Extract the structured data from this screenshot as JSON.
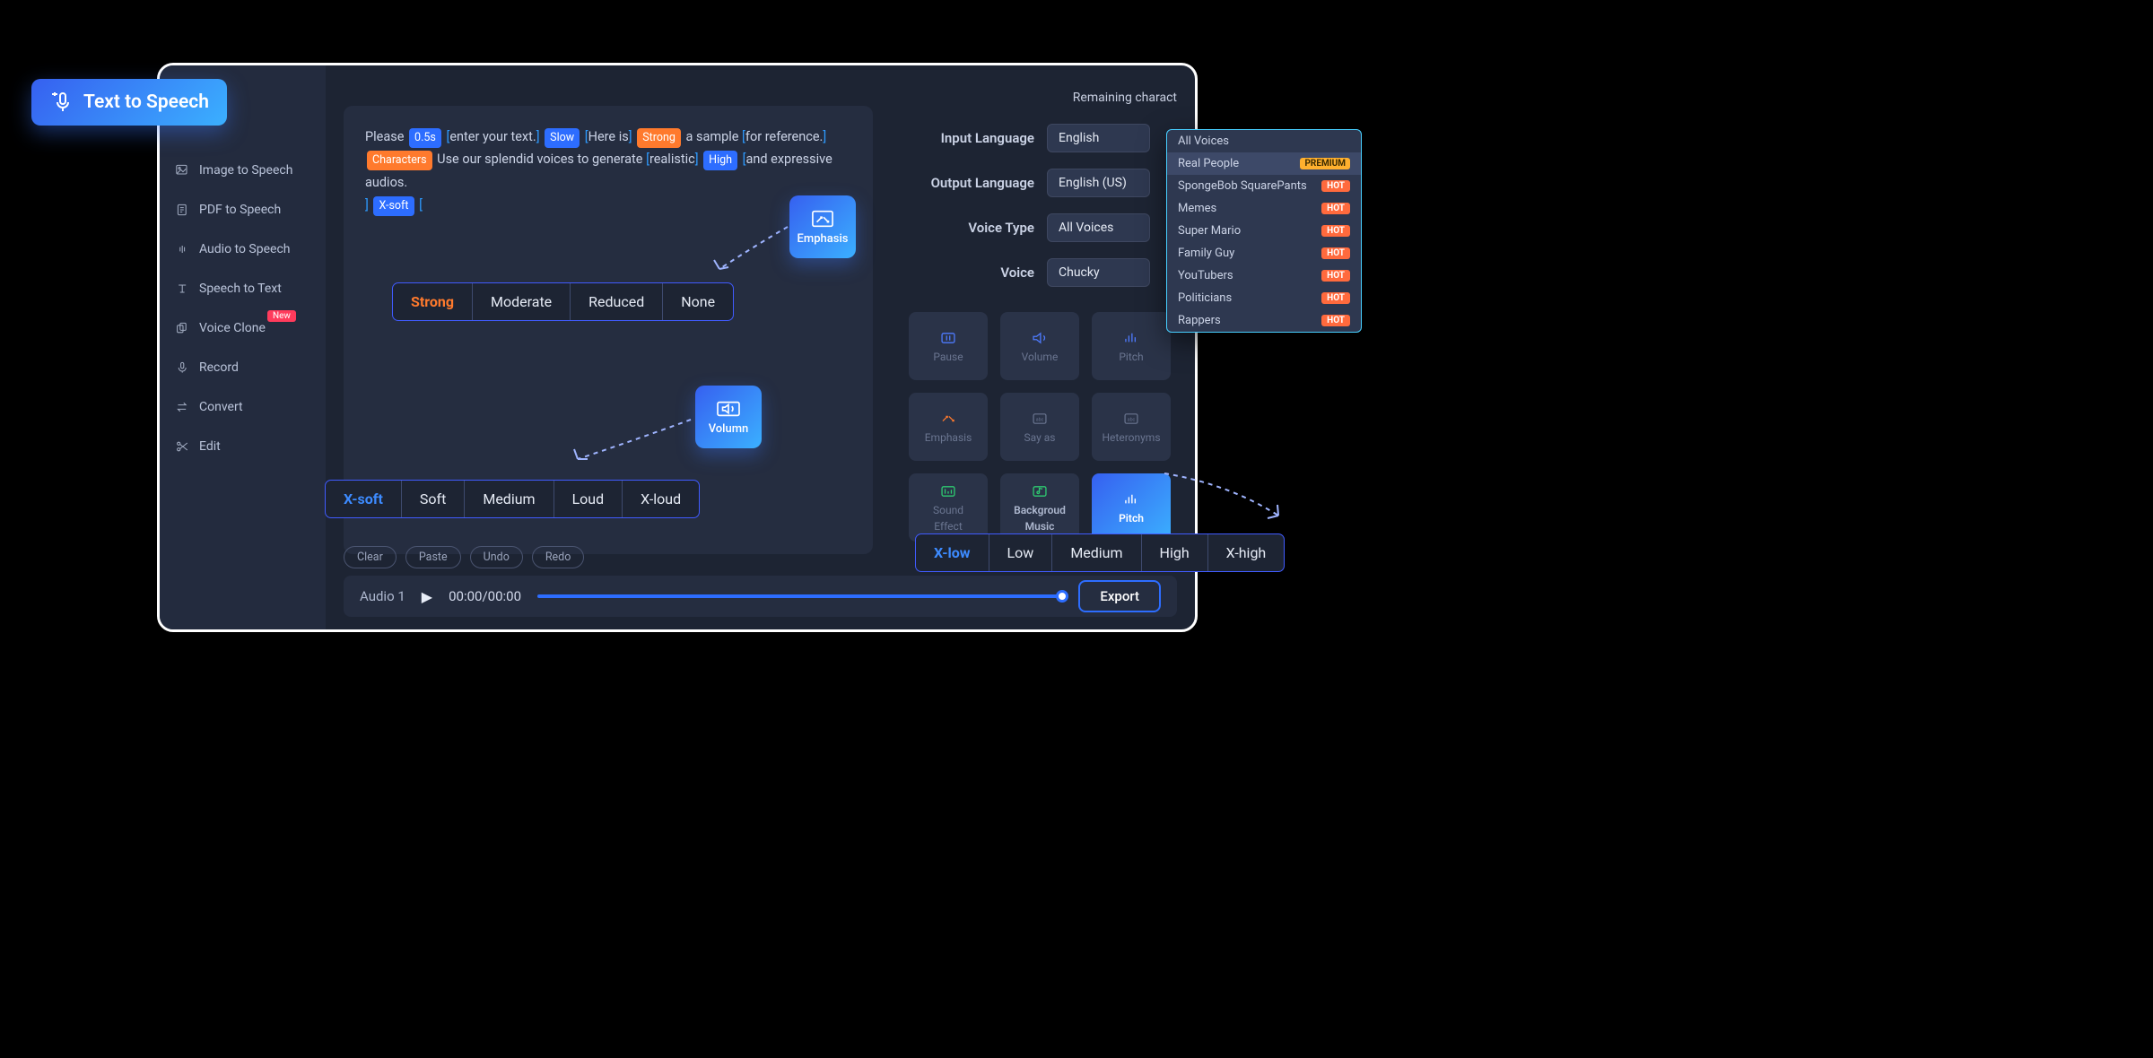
{
  "header": {
    "tts_badge": "Text  to Speech",
    "remaining": "Remaining charact"
  },
  "sidebar": {
    "items": [
      {
        "label": "Image to Speech"
      },
      {
        "label": "PDF to Speech"
      },
      {
        "label": "Audio to Speech"
      },
      {
        "label": "Speech to Text"
      },
      {
        "label": "Voice Clone",
        "badge": "New"
      },
      {
        "label": "Record"
      },
      {
        "label": "Convert"
      },
      {
        "label": "Edit"
      }
    ]
  },
  "editor": {
    "t1": "Please",
    "chip_pause": "0.5s",
    "t2": "enter your text.",
    "chip_slow": "Slow",
    "t3": "Here is",
    "chip_strong": "Strong",
    "t4": "a sample",
    "t5": "for reference.",
    "chip_chars": "Characters",
    "t6": "Use our splendid voices to generate",
    "t7": "realistic",
    "chip_high": "High",
    "t8": "and expressive audios.",
    "chip_xsoft": "X-soft"
  },
  "form": {
    "input_lang": {
      "label": "Input Language",
      "value": "English"
    },
    "output_lang": {
      "label": "Output Language",
      "value": "English (US)"
    },
    "voice_type": {
      "label": "Voice Type",
      "value": "All Voices"
    },
    "voice": {
      "label": "Voice",
      "value": "Chucky"
    }
  },
  "tools": [
    {
      "name": "Pause"
    },
    {
      "name": "Volume"
    },
    {
      "name": "Pitch"
    },
    {
      "name": "Emphasis"
    },
    {
      "name": "Say as"
    },
    {
      "name": "Heteronyms"
    },
    {
      "name_line1": "Sound",
      "name_line2": "Effect"
    },
    {
      "name_line1": "Backgroud",
      "name_line2": "Music"
    },
    {
      "name": "Pitch",
      "active": true
    }
  ],
  "floats": {
    "emphasis": "Emphasis",
    "volume": "Volumn"
  },
  "strips": {
    "emphasis": [
      "Strong",
      "Moderate",
      "Reduced",
      "None"
    ],
    "volume": [
      "X-soft",
      "Soft",
      "Medium",
      "Loud",
      "X-loud"
    ],
    "pitch": [
      "X-low",
      "Low",
      "Medium",
      "High",
      "X-high"
    ]
  },
  "dropdown": {
    "items": [
      {
        "label": "All Voices"
      },
      {
        "label": "Real People",
        "badge": "PREMIUM",
        "selected": true
      },
      {
        "label": "SpongeBob SquarePants",
        "badge": "HOT"
      },
      {
        "label": "Memes",
        "badge": "HOT"
      },
      {
        "label": "Super Mario",
        "badge": "HOT"
      },
      {
        "label": "Family Guy",
        "badge": "HOT"
      },
      {
        "label": "YouTubers",
        "badge": "HOT"
      },
      {
        "label": "Politicians",
        "badge": "HOT"
      },
      {
        "label": "Rappers",
        "badge": "HOT"
      }
    ]
  },
  "bottom": {
    "buttons": [
      "Clear",
      "Paste",
      "Undo",
      "Redo"
    ]
  },
  "player": {
    "track": "Audio 1",
    "time": "00:00/00:00",
    "export": "Export"
  }
}
